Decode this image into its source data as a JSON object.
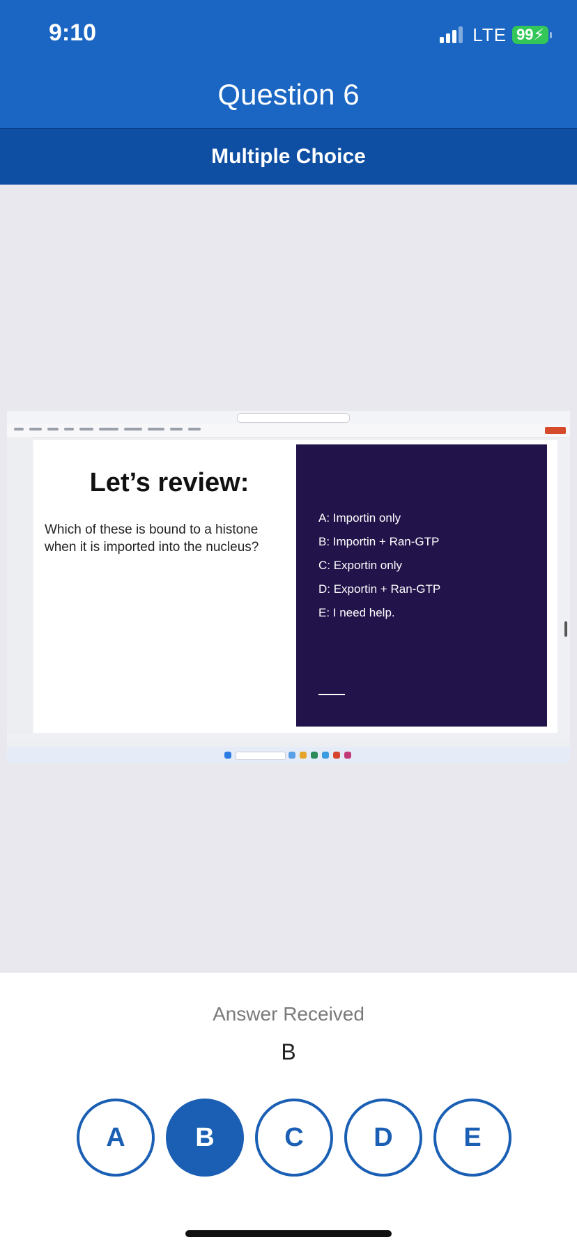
{
  "status_bar": {
    "time": "9:10",
    "network": "LTE",
    "battery": "99"
  },
  "header": {
    "title": "Question 6",
    "subtitle": "Multiple Choice"
  },
  "slide": {
    "title": "Let’s review:",
    "question": "Which of these is bound to a histone when it is imported into the nucleus?",
    "options": [
      "A: Importin only",
      "B: Importin + Ran-GTP",
      "C: Exportin only",
      "D: Exportin + Ran-GTP",
      "E: I need help."
    ]
  },
  "answer": {
    "label": "Answer Received",
    "value": "B",
    "choices": [
      "A",
      "B",
      "C",
      "D",
      "E"
    ],
    "selected": "B"
  },
  "colors": {
    "header_blue": "#1a66c2",
    "subheader_blue": "#0e4fa3",
    "choice_blue": "#1a5fb4",
    "slide_panel": "#22134a",
    "battery_green": "#33c759"
  }
}
